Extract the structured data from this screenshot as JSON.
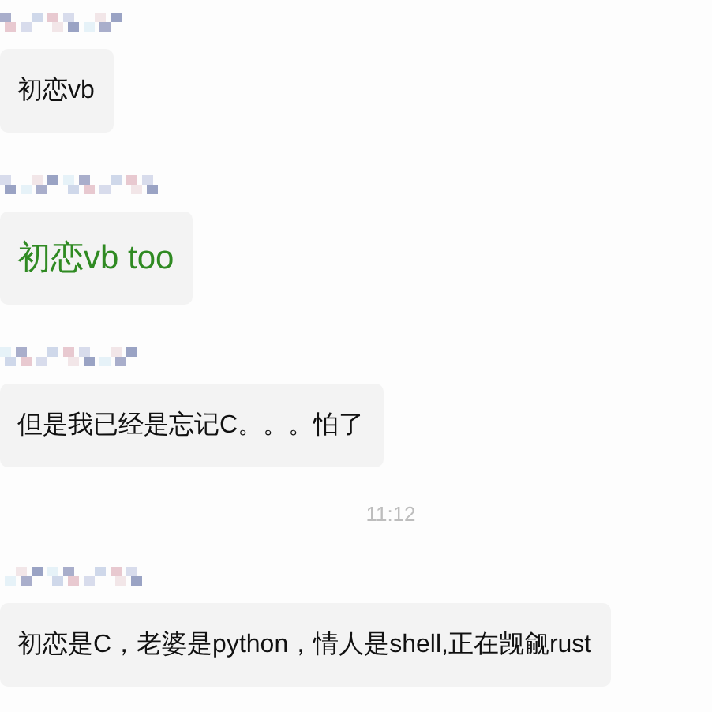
{
  "items": [
    {
      "kind": "message",
      "text": "初恋vb"
    },
    {
      "kind": "highlight",
      "text": "初恋vb too"
    },
    {
      "kind": "message",
      "text": "但是我已经是忘记C。。。怕了"
    },
    {
      "kind": "timestamp",
      "text": "11:12"
    },
    {
      "kind": "message",
      "text": "初恋是C，老婆是python，情人是shell,正在觊觎rust"
    }
  ]
}
